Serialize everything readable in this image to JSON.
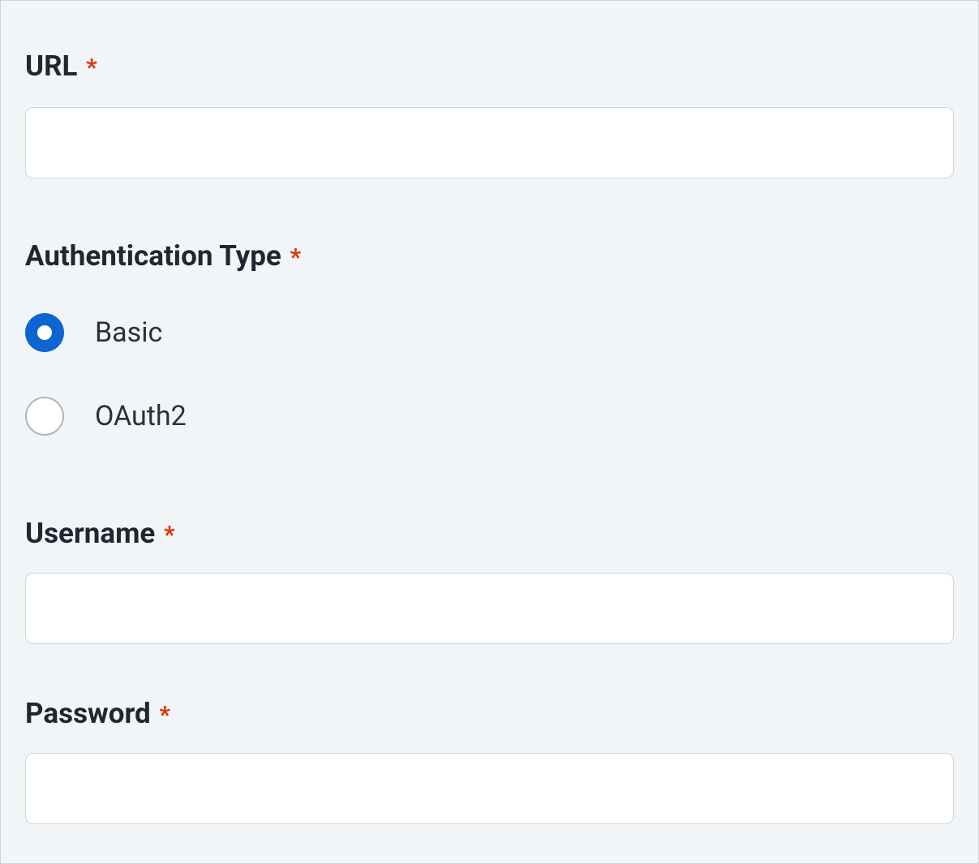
{
  "form": {
    "url": {
      "label": "URL",
      "value": ""
    },
    "authentication_type": {
      "label": "Authentication Type",
      "options": [
        {
          "label": "Basic",
          "selected": true
        },
        {
          "label": "OAuth2",
          "selected": false
        }
      ]
    },
    "username": {
      "label": "Username",
      "value": ""
    },
    "password": {
      "label": "Password",
      "value": ""
    }
  }
}
